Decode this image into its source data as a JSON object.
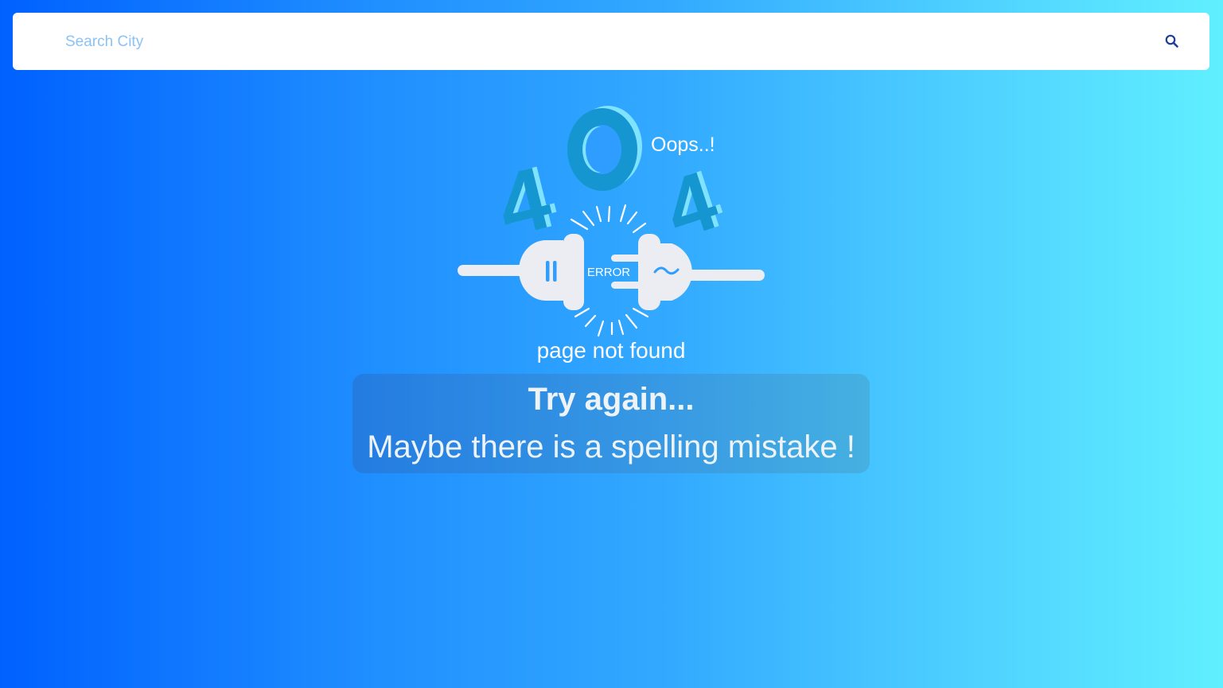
{
  "search": {
    "placeholder": "Search City",
    "value": "",
    "icon": "search-icon"
  },
  "error_graphic": {
    "code_digits": [
      "4",
      "0",
      "4"
    ],
    "exclamation": "Oops..!",
    "badge": "ERROR",
    "caption": "page not found"
  },
  "message": {
    "title": "Try again...",
    "text": "Maybe there is a spelling mistake !"
  },
  "colors": {
    "background_start": "#0061ff",
    "background_end": "#60efff",
    "digit_dark": "#1596d0",
    "digit_light": "#7fe3ff",
    "plug": "#ecedf2",
    "search_icon": "#1f3e9c",
    "placeholder": "#8cc2f5"
  }
}
